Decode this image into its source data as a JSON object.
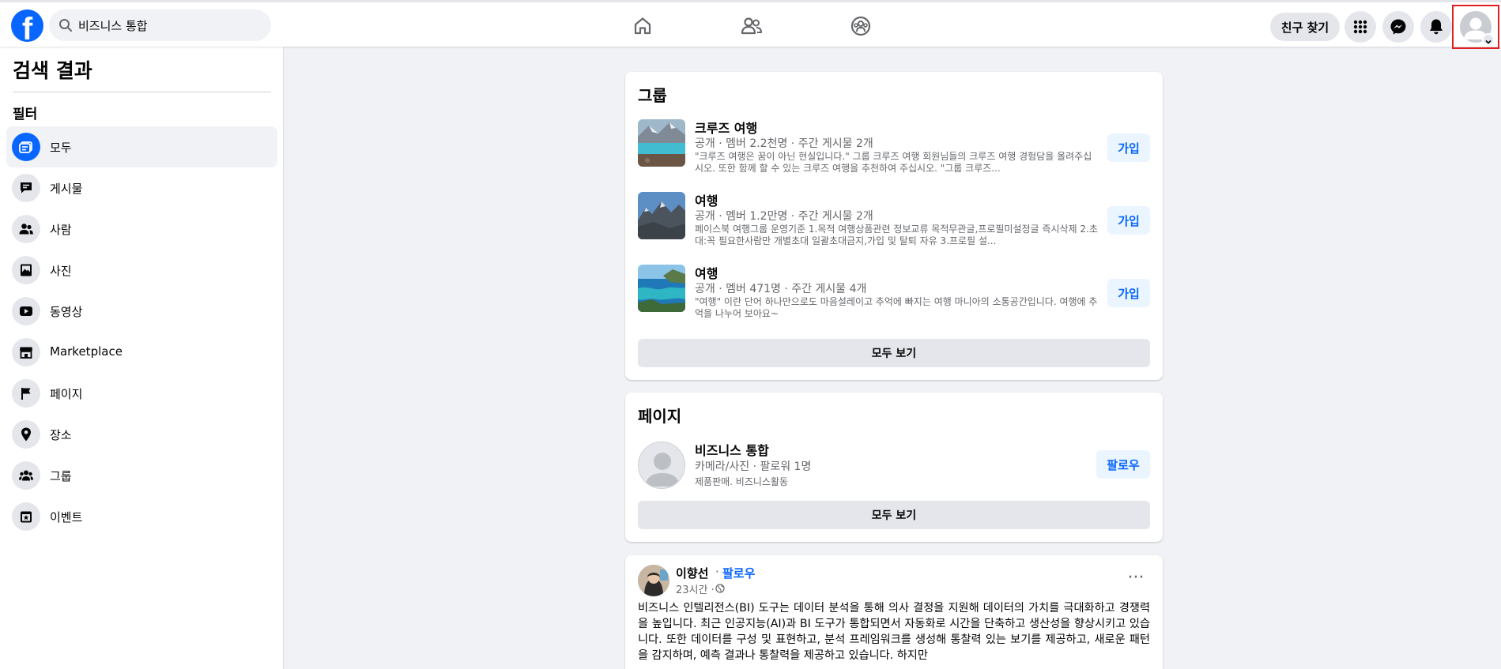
{
  "topbar": {
    "logo": "f",
    "search_value": "비즈니스 통합",
    "find_friends": "친구 찾기",
    "icons": [
      "facebook-logo",
      "search-icon",
      "home-icon",
      "friends-icon",
      "groups-icon",
      "menu-grid-icon",
      "messenger-icon",
      "bell-icon",
      "profile-avatar"
    ]
  },
  "sidebar": {
    "title": "검색 결과",
    "filter_label": "필터",
    "items": [
      {
        "label": "모두",
        "icon": "all-results-icon",
        "active": true
      },
      {
        "label": "게시물",
        "icon": "posts-icon"
      },
      {
        "label": "사람",
        "icon": "people-icon"
      },
      {
        "label": "사진",
        "icon": "photos-icon"
      },
      {
        "label": "동영상",
        "icon": "videos-icon"
      },
      {
        "label": "Marketplace",
        "icon": "marketplace-icon"
      },
      {
        "label": "페이지",
        "icon": "pages-icon"
      },
      {
        "label": "장소",
        "icon": "places-icon"
      },
      {
        "label": "그룹",
        "icon": "groups-icon"
      },
      {
        "label": "이벤트",
        "icon": "events-icon"
      }
    ]
  },
  "groups": {
    "heading": "그룹",
    "see_all": "모두 보기",
    "items": [
      {
        "name": "크루즈 여행",
        "meta": "공개 · 멤버 2.2천명 · 주간 게시물 2개",
        "desc": "\"크루즈 여행은 꿈이 아닌 현실입니다.\" 그룹 크루즈 여행 회원님들의 크루즈 여행 경험담을 올려주십시오. 또한 함께 할 수 있는 크루즈 여행을 추천하여 주십시오. \"그룹 크루즈...",
        "join": "가입"
      },
      {
        "name": "여행",
        "meta": "공개 · 멤버 1.2만명 · 주간 게시물 2개",
        "desc": "페이스북 여행그룹 운영기준 1.목적 여행상품관련 정보교류 목적무관글,프로필미설정글 즉시삭제 2.초대:꼭 필요한사람만 개별초대 일괄초대금지,가입 및 탈퇴 자유 3.프로필 설...",
        "join": "가입"
      },
      {
        "name": "여행",
        "meta": "공개 · 멤버 471명 · 주간 게시물 4개",
        "desc": "\"여행\" 이란 단어 하나만으로도 마음설레이고 추억에 빠지는 여행 마니아의 소통공간입니다. 여행에 추억을 나누어 보아요~",
        "join": "가입"
      }
    ]
  },
  "pages": {
    "heading": "페이지",
    "see_all": "모두 보기",
    "item": {
      "name": "비즈니스 통합",
      "meta": "카메라/사진 · 팔로워 1명",
      "desc": "제품판매. 비즈니스활동",
      "follow": "팔로우"
    }
  },
  "post": {
    "author": "이향선",
    "separator": "·",
    "follow": "팔로우",
    "time": "23시간 ·",
    "more": "···",
    "body": "비즈니스 인텔리전스(BI) 도구는 데이터 분석을 통해 의사 결정을 지원해 데이터의 가치를 극대화하고 경쟁력을 높입니다. 최근 인공지능(AI)과 BI 도구가 통합되면서 자동화로 시간을 단축하고 생산성을 향상시키고 있습니다. 또한 데이터를 구성 및 표현하고, 분석 프레임워크를 생성해 통찰력 있는 보기를 제공하고, 새로운 패턴을 감지하며, 예측 결과나 통찰력을 제공하고 있습니다. 하지만"
  },
  "colors": {
    "brand_blue": "#0866ff",
    "page_bg": "#f0f2f5",
    "highlight_red": "#e02020"
  }
}
